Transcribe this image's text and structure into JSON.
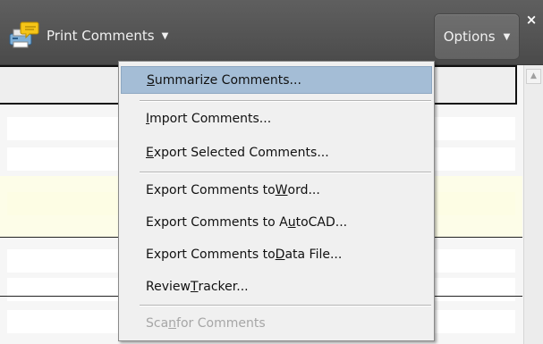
{
  "toolbar": {
    "print_label": "Print Comments",
    "print_caret": "▼",
    "options_label": "Options",
    "options_caret": "▼",
    "close_glyph": "×",
    "icons": {
      "print": "printer-comment-icon",
      "close": "close-icon"
    }
  },
  "menu": {
    "items": [
      {
        "pre": "",
        "ul": "S",
        "post": "ummarize Comments...",
        "state": "highlighted"
      },
      {
        "pre": "",
        "ul": "I",
        "post": "mport Comments...",
        "state": "enabled"
      },
      {
        "pre": "",
        "ul": "E",
        "post": "xport Selected Comments...",
        "state": "enabled"
      },
      {
        "pre": "Export Comments to ",
        "ul": "W",
        "post": "ord...",
        "state": "enabled"
      },
      {
        "pre": "Export Comments to A",
        "ul": "u",
        "post": "toCAD...",
        "state": "enabled"
      },
      {
        "pre": "Export Comments to ",
        "ul": "D",
        "post": "ata File...",
        "state": "enabled"
      },
      {
        "pre": "Review ",
        "ul": "T",
        "post": "racker...",
        "state": "enabled"
      },
      {
        "pre": "Sca",
        "ul": "n",
        "post": " for Comments",
        "state": "disabled"
      }
    ]
  },
  "scrollbar": {
    "up_arrow": "▲",
    "icon": "scroll-up-arrow-icon"
  },
  "colors": {
    "toolbar_bg": "#535353",
    "menu_bg": "#f0f0f0",
    "menu_highlight": "#a4bdd6",
    "disabled_text": "#a6a6a6"
  }
}
